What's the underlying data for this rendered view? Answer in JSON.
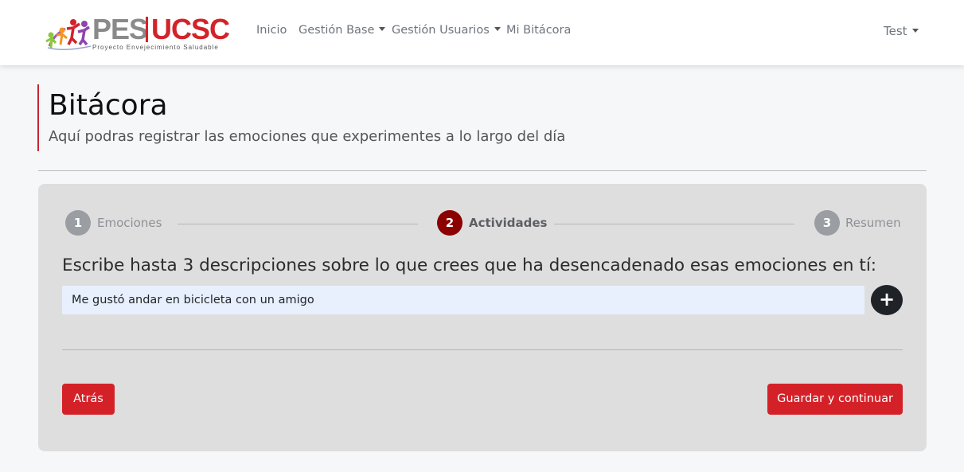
{
  "brand": {
    "logo_text_left": "PES",
    "logo_text_right": "UCSC",
    "logo_tagline": "Proyecto Envejecimiento Saludable"
  },
  "nav": {
    "items": [
      {
        "label": "Inicio"
      },
      {
        "label": "Gestión Base"
      },
      {
        "label": "Gestión Usuarios"
      },
      {
        "label": "Mi Bitácora"
      }
    ],
    "user_label": "Test"
  },
  "header": {
    "title": "Bitácora",
    "subtitle": "Aquí podras registrar las emociones que experimentes a lo largo del día"
  },
  "stepper": {
    "steps": [
      {
        "number": "1",
        "label": "Emociones"
      },
      {
        "number": "2",
        "label": "Actividades"
      },
      {
        "number": "3",
        "label": "Resumen"
      }
    ]
  },
  "form": {
    "question": "Escribe hasta 3 descripciones sobre lo que crees que ha desencadenado esas emociones en tí:",
    "description_value": "Me gustó andar en bicicleta con un amigo",
    "add_icon_glyph": "+"
  },
  "actions": {
    "back_label": "Atrás",
    "save_label": "Guardar y continuar"
  },
  "colors": {
    "brand_red": "#d42128",
    "step_active": "#8b0000",
    "step_inactive": "#9a9da1",
    "card_bg": "#dedede"
  }
}
